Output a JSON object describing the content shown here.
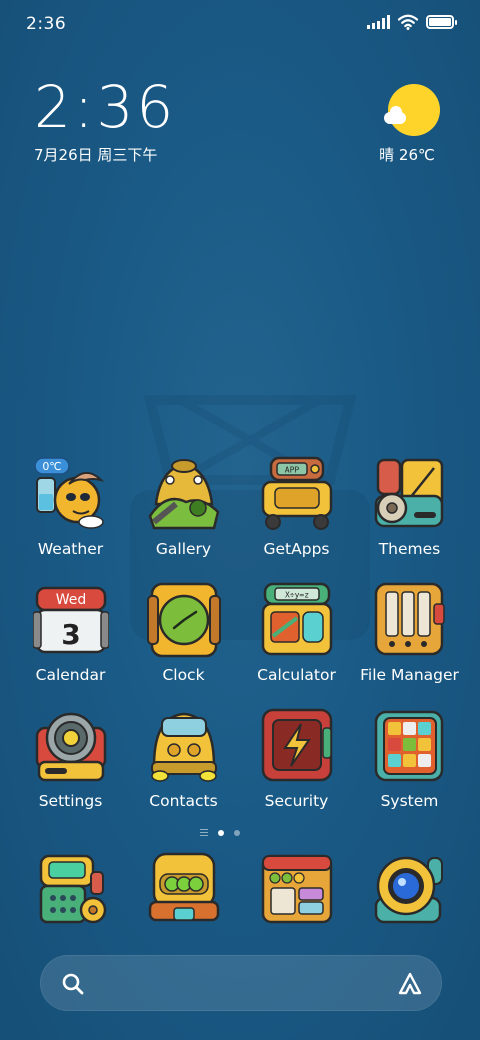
{
  "status_bar": {
    "time": "2:36",
    "icons": [
      "signal-icon",
      "wifi-icon",
      "battery-icon"
    ]
  },
  "clock_widget": {
    "time": "2:36",
    "date": "7月26日 周三下午"
  },
  "weather_widget": {
    "condition": "晴",
    "temperature": "26℃",
    "text": "晴 26℃",
    "icon": "sunny-partly-cloudy-icon"
  },
  "apps": [
    {
      "label": "Weather",
      "icon": "weather-icon",
      "badge": "0℃"
    },
    {
      "label": "Gallery",
      "icon": "gallery-icon"
    },
    {
      "label": "GetApps",
      "icon": "getapps-icon",
      "badge": "APP"
    },
    {
      "label": "Themes",
      "icon": "themes-icon"
    },
    {
      "label": "Calendar",
      "icon": "calendar-icon",
      "day_name": "Wed",
      "day_number": "3"
    },
    {
      "label": "Clock",
      "icon": "clock-icon"
    },
    {
      "label": "Calculator",
      "icon": "calculator-icon",
      "display": "X÷y=z"
    },
    {
      "label": "File Manager",
      "icon": "file-manager-icon"
    },
    {
      "label": "Settings",
      "icon": "settings-icon"
    },
    {
      "label": "Contacts",
      "icon": "contacts-icon"
    },
    {
      "label": "Security",
      "icon": "security-icon"
    },
    {
      "label": "System",
      "icon": "system-icon"
    }
  ],
  "page_indicator": {
    "pages": 2,
    "active": 0
  },
  "dock": [
    {
      "icon": "phone-icon"
    },
    {
      "icon": "messages-icon"
    },
    {
      "icon": "browser-icon"
    },
    {
      "icon": "camera-icon"
    }
  ],
  "search_bar": {
    "icons": [
      "search-icon",
      "assistant-icon"
    ]
  },
  "colors": {
    "background": "#1a5a86",
    "accent_yellow": "#f2c23a",
    "sun": "#ffd42a"
  }
}
